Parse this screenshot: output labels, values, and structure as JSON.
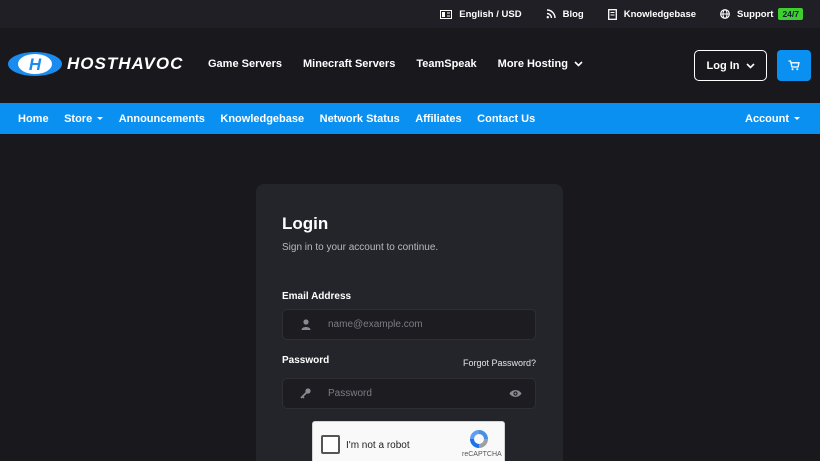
{
  "topbar": {
    "language": "English / USD",
    "blog": "Blog",
    "knowledgebase": "Knowledgebase",
    "support": "Support",
    "support_badge": "24/7"
  },
  "brand": {
    "name": "HOSTHAVOC",
    "color": "#1a8cf0"
  },
  "nav": {
    "items": [
      "Game Servers",
      "Minecraft Servers",
      "TeamSpeak",
      "More Hosting"
    ],
    "login_label": "Log In"
  },
  "subnav": {
    "items": [
      "Home",
      "Store",
      "Announcements",
      "Knowledgebase",
      "Network Status",
      "Affiliates",
      "Contact Us"
    ],
    "account": "Account",
    "color": "#0a90f0"
  },
  "login": {
    "title": "Login",
    "subtitle": "Sign in to your account to continue.",
    "email_label": "Email Address",
    "email_placeholder": "name@example.com",
    "password_label": "Password",
    "forgot": "Forgot Password?",
    "password_placeholder": "Password"
  },
  "captcha": {
    "label": "I'm not a robot",
    "brand": "reCAPTCHA"
  }
}
